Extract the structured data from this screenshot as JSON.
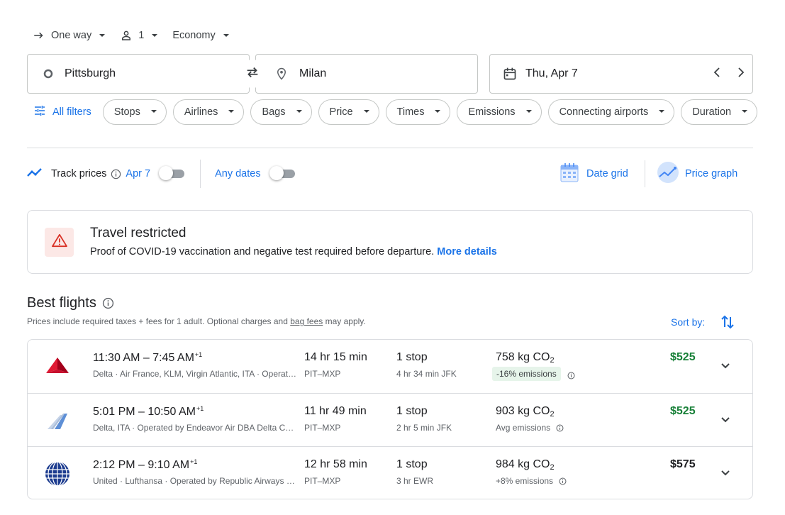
{
  "trip": {
    "type_label": "One way",
    "passengers": "1",
    "cabin": "Economy"
  },
  "search": {
    "origin": "Pittsburgh",
    "destination": "Milan",
    "date": "Thu, Apr 7"
  },
  "filters": {
    "all_filters_label": "All filters",
    "chips": [
      "Stops",
      "Airlines",
      "Bags",
      "Price",
      "Times",
      "Emissions",
      "Connecting airports",
      "Duration"
    ]
  },
  "tracking": {
    "label": "Track prices",
    "date_label": "Apr 7",
    "any_dates_label": "Any dates",
    "date_grid_label": "Date grid",
    "price_graph_label": "Price graph"
  },
  "restriction": {
    "title": "Travel restricted",
    "description": "Proof of COVID-19 vaccination and negative test required before departure.",
    "link": "More details"
  },
  "best": {
    "title": "Best flights",
    "subtitle_pre": "Prices include required taxes + fees for 1 adult. Optional charges and ",
    "subtitle_link": "bag fees",
    "subtitle_post": " may apply.",
    "sort_label": "Sort by:"
  },
  "colors": {
    "accent": "#1a73e8",
    "price_green": "#188038",
    "price_default": "#202124",
    "emission_badge_bg": "#e6f4ea",
    "warning_red": "#d93025"
  },
  "flights": [
    {
      "logo": "delta-logo",
      "times": "11:30 AM – 7:45 AM",
      "day_offset": "+1",
      "airlines": "Delta · Air France, KLM, Virgin Atlantic, ITA · Operated by Delta",
      "duration": "14 hr 15 min",
      "route": "PIT–MXP",
      "stops": "1 stop",
      "layover": "4 hr 34 min JFK",
      "co2_value": "758 kg CO",
      "co2_sub": "2",
      "emissions": "-16% emissions",
      "emissions_badge": true,
      "price": "$525",
      "price_color": "#188038"
    },
    {
      "logo": "endeavor-logo",
      "times": "5:01 PM – 10:50 AM",
      "day_offset": "+1",
      "airlines": "Delta, ITA · Operated by Endeavor Air DBA Delta Connection",
      "duration": "11 hr 49 min",
      "route": "PIT–MXP",
      "stops": "1 stop",
      "layover": "2 hr 5 min JFK",
      "co2_value": "903 kg CO",
      "co2_sub": "2",
      "emissions": "Avg emissions",
      "emissions_badge": false,
      "price": "$525",
      "price_color": "#188038"
    },
    {
      "logo": "united-logo",
      "times": "2:12 PM – 9:10 AM",
      "day_offset": "+1",
      "airlines": "United · Lufthansa · Operated by Republic Airways DBA United Express",
      "duration": "12 hr 58 min",
      "route": "PIT–MXP",
      "stops": "1 stop",
      "layover": "3 hr EWR",
      "co2_value": "984 kg CO",
      "co2_sub": "2",
      "emissions": "+8% emissions",
      "emissions_badge": false,
      "price": "$575",
      "price_color": "#202124"
    }
  ]
}
